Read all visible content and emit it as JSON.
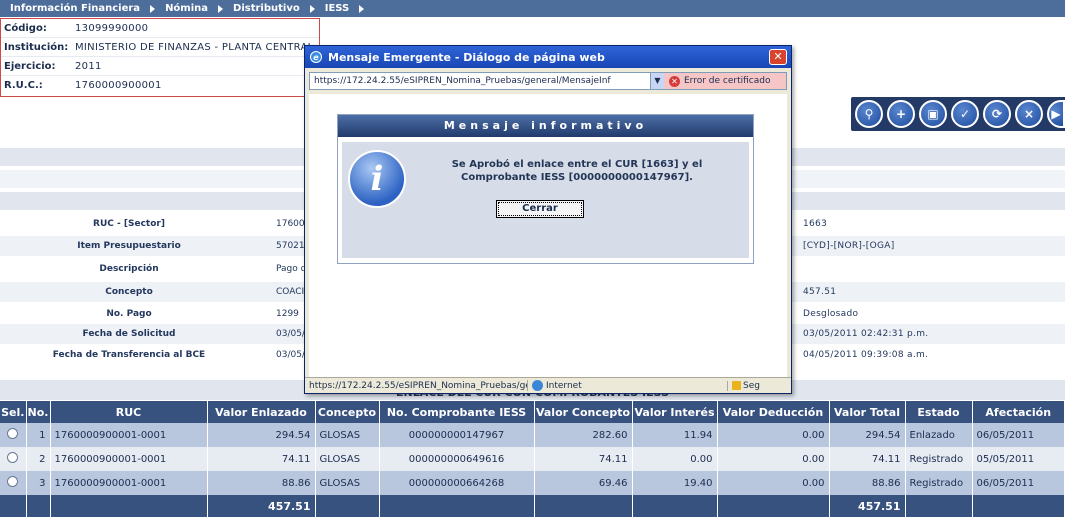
{
  "nav": {
    "breadcrumbs": [
      "Información Financiera",
      "Nómina",
      "Distributivo",
      "IESS"
    ]
  },
  "info": {
    "codigo_label": "Código:",
    "codigo": "13099990000",
    "institucion_label": "Institución:",
    "institucion": "MINISTERIO DE FINANZAS - PLANTA CENTRAL",
    "ejercicio_label": "Ejercicio:",
    "ejercicio": "2011",
    "ruc_label": "R.U.C.:",
    "ruc": "1760000900001"
  },
  "toolbar": {
    "icons": [
      "preview-icon",
      "add-icon",
      "save-icon",
      "approve-icon",
      "refresh-icon",
      "delete-icon",
      "exit-icon"
    ]
  },
  "detail": {
    "rows": [
      {
        "label": "RUC - [Sector]",
        "value": "17600",
        "right": "1663"
      },
      {
        "label": "Item Presupuestario",
        "value": "57021",
        "right": "[CYD]-[NOR]-[OGA]"
      },
      {
        "label": "Descripción",
        "value": "Pago d",
        "right": ""
      },
      {
        "label": "Concepto",
        "value": "COACI",
        "right": "457.51"
      },
      {
        "label": "No. Pago",
        "value": "1299",
        "right": "Desglosado"
      },
      {
        "label": "Fecha de Solicitud",
        "value": "03/05/",
        "right": "03/05/2011 02:42:31 p.m."
      },
      {
        "label": "Fecha de Transferencia al BCE",
        "value": "03/05/",
        "right": "04/05/2011 09:39:08 a.m."
      }
    ],
    "section_title": "ENLACE DEL CUR CON COMPROBANTES IESS"
  },
  "table": {
    "columns": [
      "Sel.",
      "No.",
      "RUC",
      "Valor Enlazado",
      "Concepto",
      "No. Comprobante IESS",
      "Valor Concepto",
      "Valor Interés",
      "Valor Deducción",
      "Valor Total",
      "Estado",
      "Afectación"
    ],
    "rows": [
      {
        "no": "1",
        "ruc": "1760000900001-0001",
        "enlazado": "294.54",
        "concepto": "GLOSAS",
        "comprobante": "000000000147967",
        "vconcepto": "282.60",
        "interes": "11.94",
        "deduccion": "0.00",
        "total": "294.54",
        "estado": "Enlazado",
        "afectacion": "06/05/2011"
      },
      {
        "no": "2",
        "ruc": "1760000900001-0001",
        "enlazado": "74.11",
        "concepto": "GLOSAS",
        "comprobante": "000000000649616",
        "vconcepto": "74.11",
        "interes": "0.00",
        "deduccion": "0.00",
        "total": "74.11",
        "estado": "Registrado",
        "afectacion": "05/05/2011"
      },
      {
        "no": "3",
        "ruc": "1760000900001-0001",
        "enlazado": "88.86",
        "concepto": "GLOSAS",
        "comprobante": "000000000664268",
        "vconcepto": "69.46",
        "interes": "19.40",
        "deduccion": "0.00",
        "total": "88.86",
        "estado": "Registrado",
        "afectacion": "06/05/2011"
      }
    ],
    "totals": {
      "enlazado": "457.51",
      "total": "457.51"
    }
  },
  "popup": {
    "title": "Mensaje Emergente - Diálogo de página web",
    "url": "https://172.24.2.55/eSIPREN_Nomina_Pruebas/general/MensajeInf",
    "cert_error": "Error de certificado",
    "message_title": "Mensaje informativo",
    "message": "Se Aprobó el enlace entre el CUR [1663] y el\nComprobante IESS [0000000000147967].",
    "button": "Cerrar",
    "status_url": "https://172.24.2.55/eSIPREN_Nomina_Pruebas/general/Men",
    "zone": "Internet",
    "security": "Seg"
  },
  "colors": {
    "header_blue": "#37527f",
    "nav_blue": "#4d6d9a",
    "row_alt": "#b8c6de",
    "info_border": "#d04848"
  }
}
